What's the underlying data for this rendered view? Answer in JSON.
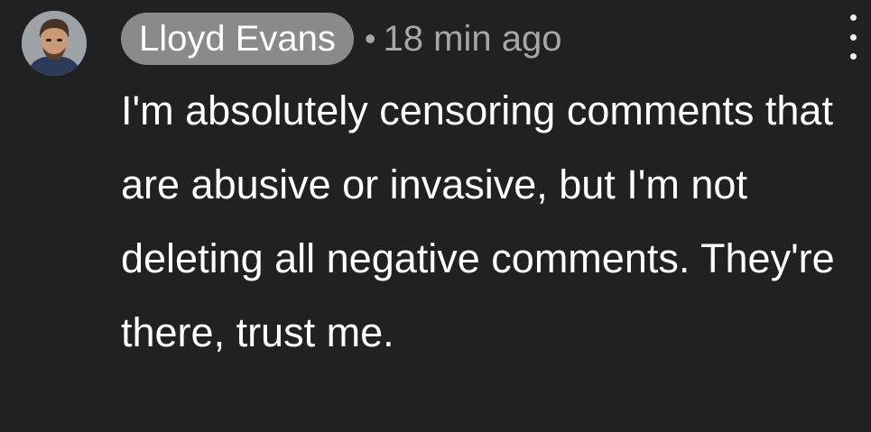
{
  "comment": {
    "author": "Lloyd Evans",
    "separator": "•",
    "timestamp": "18 min ago",
    "avatar_icon": "user-avatar-photo",
    "more_icon": "more-vertical-icon",
    "text": "I'm absolutely censoring comments that are abusive or invasive, but I'm not deleting all negative comments. They're there, trust me."
  },
  "colors": {
    "background": "#212121",
    "author_chip": "#8a8a8a",
    "meta_text": "#a7a7a7",
    "body_text": "#ffffff"
  }
}
